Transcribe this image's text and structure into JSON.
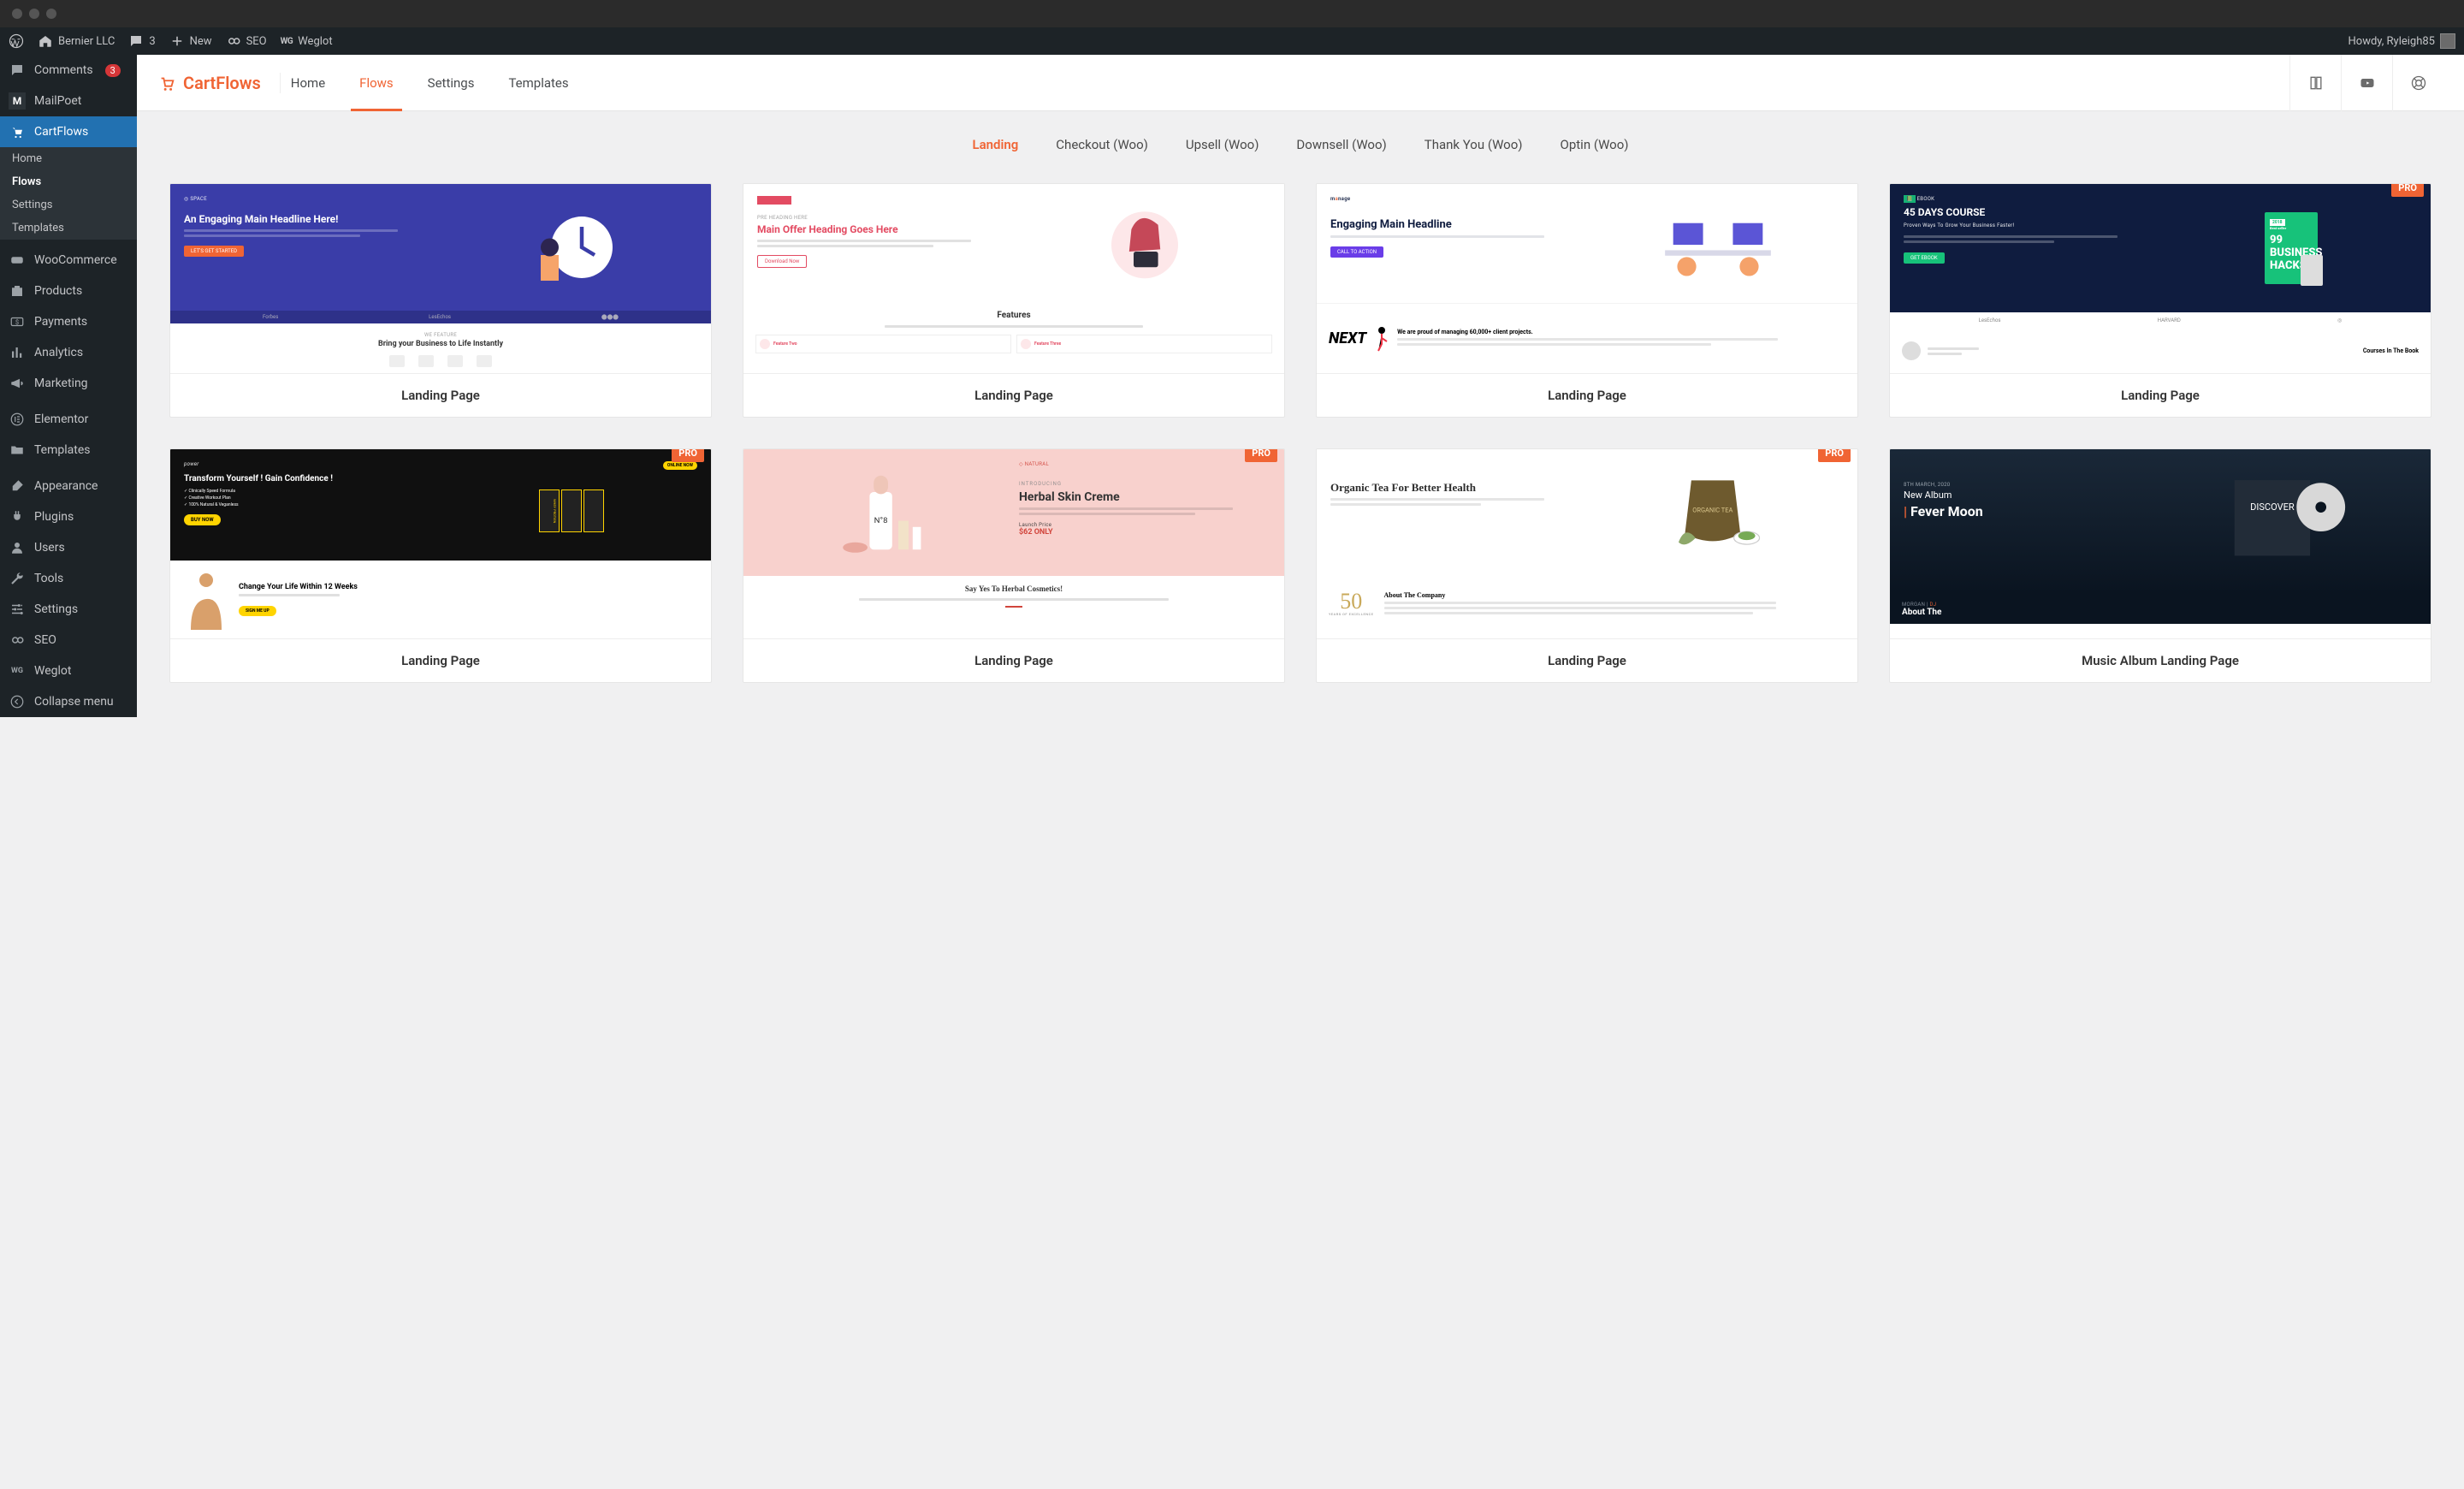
{
  "titlebar": {},
  "adminbar": {
    "site_name": "Bernier LLC",
    "comment_count": "3",
    "new_label": "New",
    "seo_label": "SEO",
    "weglot_label": "Weglot",
    "greeting": "Howdy, Ryleigh85"
  },
  "sidebar": {
    "items": [
      {
        "id": "comments",
        "label": "Comments",
        "badge": "3"
      },
      {
        "id": "mailpoet",
        "label": "MailPoet"
      },
      {
        "id": "cartflows",
        "label": "CartFlows",
        "active": true
      },
      {
        "id": "woocommerce",
        "label": "WooCommerce"
      },
      {
        "id": "products",
        "label": "Products"
      },
      {
        "id": "payments",
        "label": "Payments"
      },
      {
        "id": "analytics",
        "label": "Analytics"
      },
      {
        "id": "marketing",
        "label": "Marketing"
      },
      {
        "id": "elementor",
        "label": "Elementor"
      },
      {
        "id": "templates",
        "label": "Templates"
      },
      {
        "id": "appearance",
        "label": "Appearance"
      },
      {
        "id": "plugins",
        "label": "Plugins"
      },
      {
        "id": "users",
        "label": "Users"
      },
      {
        "id": "tools",
        "label": "Tools"
      },
      {
        "id": "settings",
        "label": "Settings"
      },
      {
        "id": "seo",
        "label": "SEO"
      },
      {
        "id": "weglot",
        "label": "Weglot"
      },
      {
        "id": "collapse",
        "label": "Collapse menu"
      }
    ],
    "submenu": [
      {
        "id": "home",
        "label": "Home"
      },
      {
        "id": "flows",
        "label": "Flows",
        "current": true
      },
      {
        "id": "settings",
        "label": "Settings"
      },
      {
        "id": "templates",
        "label": "Templates"
      }
    ]
  },
  "app": {
    "brand": "CartFlows",
    "nav": [
      {
        "id": "home",
        "label": "Home"
      },
      {
        "id": "flows",
        "label": "Flows",
        "active": true
      },
      {
        "id": "settings",
        "label": "Settings"
      },
      {
        "id": "templates",
        "label": "Templates"
      }
    ]
  },
  "filters": [
    {
      "id": "landing",
      "label": "Landing",
      "active": true
    },
    {
      "id": "checkout",
      "label": "Checkout (Woo)"
    },
    {
      "id": "upsell",
      "label": "Upsell (Woo)"
    },
    {
      "id": "downsell",
      "label": "Downsell (Woo)"
    },
    {
      "id": "thankyou",
      "label": "Thank You (Woo)"
    },
    {
      "id": "optin",
      "label": "Optin (Woo)"
    }
  ],
  "templates": [
    {
      "title": "Landing Page",
      "pro": false,
      "thumb": {
        "badge": "SPACE",
        "headline": "An Engaging Main Headline Here!",
        "cta": "LET'S GET STARTED",
        "lower": "Bring your Business to Life Instantly",
        "brands": [
          "Forbes",
          "LesEchos"
        ],
        "bg": "#3a3da8",
        "fg": "#ffffff",
        "accent": "#f06434"
      }
    },
    {
      "title": "Landing Page",
      "pro": false,
      "thumb": {
        "badge": "PRE HEADING HERE",
        "headline": "Main Offer Heading Goes Here",
        "cta": "Download Now",
        "lower_title": "Features",
        "feat1": "Feature Two",
        "feat2": "Feature Three",
        "bg": "#ffffff",
        "fg": "#333333",
        "accent": "#e34b62"
      }
    },
    {
      "title": "Landing Page",
      "pro": false,
      "thumb": {
        "badge": "manage",
        "headline": "Engaging Main Headline",
        "cta": "CALL TO ACTION",
        "lower_brand": "NEXT",
        "lower_text": "We are proud of managing 60,000+ client projects.",
        "bg": "#ffffff",
        "fg": "#0f1c3f",
        "accent": "#6a3de8"
      }
    },
    {
      "title": "Landing Page",
      "pro": true,
      "thumb": {
        "badge": "EBOOK",
        "headline": "45 DAYS COURSE",
        "sub": "Proven Ways To Grow Your Business Faster!",
        "book_year": "2018",
        "book_tag": "Best seller",
        "book_title": "99 BUSINESS HACKS",
        "cta": "GET EBOOK",
        "lower": "Courses In The Book",
        "brands": [
          "LesEchos",
          "HARVARD"
        ],
        "bg": "#0f1c3f",
        "fg": "#ffffff",
        "accent": "#17c27a"
      }
    },
    {
      "title": "Landing Page",
      "pro": true,
      "thumb": {
        "badge": "power",
        "pill": "ONLINE NOW",
        "headline": "Transform Yourself ! Gain Confidence !",
        "bullets": [
          "Clinically Speed Formula",
          "Creative Workout Plan",
          "100% Natural & Veganless"
        ],
        "cta": "BUY NOW",
        "product": "WHEY PROTIEN",
        "lower_head": "Change Your Life Within 12 Weeks",
        "lower_cta": "SIGN ME UP",
        "bg": "#101010",
        "fg": "#ffffff",
        "accent": "#ffd400"
      }
    },
    {
      "title": "Landing Page",
      "pro": true,
      "thumb": {
        "badge": "NATURAL",
        "intro": "INTRODUCING",
        "headline": "Herbal Skin Creme",
        "price_label": "Launch Price",
        "price": "$62 ONLY",
        "lower": "Say Yes To Herbal Cosmetics!",
        "bg": "#f8d1cd",
        "fg": "#333333",
        "accent": "#d1453c"
      }
    },
    {
      "title": "Landing Page",
      "pro": true,
      "thumb": {
        "headline": "Organic Tea For Better Health",
        "pack": "ORGANIC TEA",
        "lower_num": "50",
        "lower_years": "YEARS OF EXCELLENCE",
        "lower_title": "About The Company",
        "bg": "#ffffff",
        "fg": "#2d2d2d",
        "accent": "#6e5a2e"
      }
    },
    {
      "title": "Music Album Landing Page",
      "pro": false,
      "thumb": {
        "date": "8TH MARCH, 2020",
        "sub": "New Album",
        "headline": "Fever Moon",
        "disc": "DISCOVER",
        "lower": "About The",
        "bg": "#0a1420",
        "fg": "#ffffff",
        "accent": "#f06434"
      }
    }
  ],
  "labels": {
    "pro_badge": "PRO"
  }
}
